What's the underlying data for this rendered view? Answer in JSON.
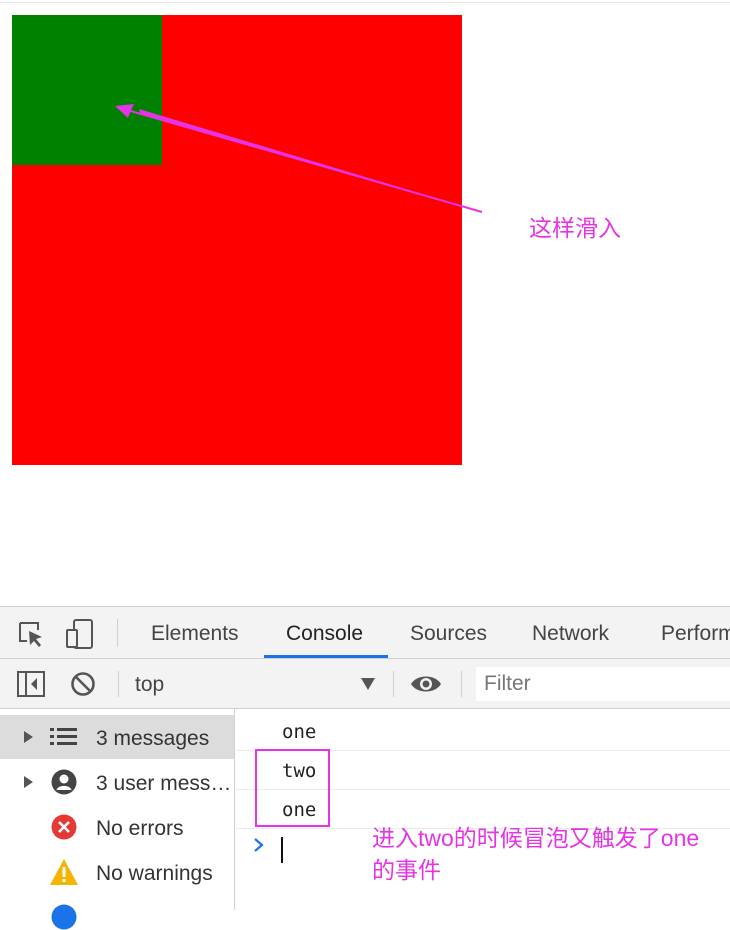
{
  "annotations": {
    "slide_in": "这样滑入",
    "explanation": "进入two的时候冒泡又触发了one的事件"
  },
  "colors": {
    "box_one": "#ff0000",
    "box_two": "#008000",
    "annotation": "#e633e6",
    "active_tab": "#1a73e8"
  },
  "devtools": {
    "tabs": [
      {
        "label": "Elements"
      },
      {
        "label": "Console",
        "active": true
      },
      {
        "label": "Sources"
      },
      {
        "label": "Network"
      },
      {
        "label": "Perform"
      }
    ],
    "toolbar": {
      "context": "top",
      "filter_placeholder": "Filter"
    },
    "sidebar": [
      {
        "label": "3 messages",
        "icon": "list-icon",
        "selected": true
      },
      {
        "label": "3 user mess…",
        "icon": "user-icon"
      },
      {
        "label": "No errors",
        "icon": "error-icon"
      },
      {
        "label": "No warnings",
        "icon": "warning-icon"
      }
    ],
    "console_logs": [
      "one",
      "two",
      "one"
    ]
  }
}
